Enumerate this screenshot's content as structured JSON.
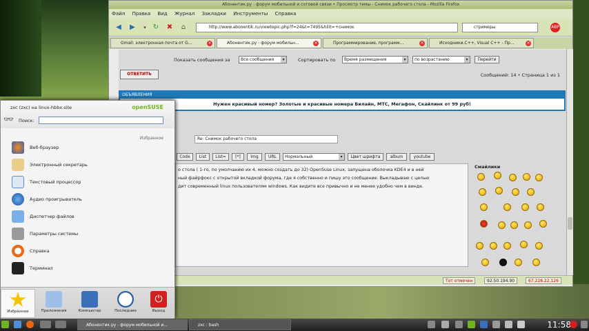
{
  "window": {
    "title": "Абонентик.ру - форум мобильной и сотовой связи • Просмотр темы - Снимок рабочего стола - Mozilla Firefox",
    "menu": [
      "Файл",
      "Правка",
      "Вид",
      "Журнал",
      "Закладки",
      "Инструменты",
      "Справка"
    ],
    "url": "http://www.abonentik.ru/viewtopic.php?f=24&t=7495&hilit=+снимок",
    "search_value": "стримеры",
    "tabs": [
      {
        "label": "Gmail: электронная почта от G...",
        "active": false
      },
      {
        "label": "Абонентик.ру - форум мобильн...",
        "active": true
      },
      {
        "label": "Программирование, программ...",
        "active": false
      },
      {
        "label": "Исходники.C++, Visual C++ - Пр...",
        "active": false
      }
    ],
    "status": {
      "left": "",
      "certificate": "Тот отмечен",
      "ip1": "92.50.194.90",
      "ip2": "67.228.22.126"
    }
  },
  "forum": {
    "show_label": "Показать сообщения за",
    "show_value": "Все сообщения",
    "sort_label": "Сортировать по",
    "sort_value": "Время размещения",
    "order_value": "по возрастанию",
    "go_button": "Перейти",
    "reply_button": "ОТВЕТИТЬ",
    "pagination": "Сообщений: 14 • Страница 1 из 1",
    "ad_header": "ОБЪЯВЛЕНИЯ",
    "ad_text": "Нужен красивый номер? Золотые и красивые номера Билайн, МТС, Мегафон, Скайлинк от 99 руб!",
    "subject_value": "Re: Снимок рабочего стола",
    "toolbar": [
      "Code",
      "List",
      "List=",
      "[*]",
      "Img",
      "URL"
    ],
    "font_size_value": "Нормальный",
    "toolbar2": [
      "Цвет шрифта",
      "album",
      "youtube"
    ],
    "body_lines": [
      "о стола ( 1-го, по умолчанию их 4, можно создать до 32) OpenSuse Linux, запущена оболочка KDE4 и в ней",
      "ный файрфокс с открытой вкладкой форума, где я собственно и пишу это сообщение. Выкладываю с целью",
      "дит современный linux пользователям  windows. Как видите все привычно и не менее удобно чем в винде."
    ],
    "smilies_title": "Смайлики"
  },
  "kmenu": {
    "user": "zxc (zxc) на linux-hbbx.site",
    "brand": "openSUSE",
    "search_label": "Поиск:",
    "search_value": "",
    "section": "Избранное",
    "items": [
      {
        "label": "Веб-браузер",
        "icon": "firefox-icon",
        "color": "#e8661a"
      },
      {
        "label": "Электронный секретарь",
        "icon": "organizer-icon",
        "color": "#d9b34a"
      },
      {
        "label": "Текстовый процессор",
        "icon": "text-processor-icon",
        "color": "#5a8fcf"
      },
      {
        "label": "Аудио проигрыватель",
        "icon": "audio-player-icon",
        "color": "#2c6fbf"
      },
      {
        "label": "Диспетчер файлов",
        "icon": "file-manager-icon",
        "color": "#4d8fd9"
      },
      {
        "label": "Параметры системы",
        "icon": "system-settings-icon",
        "color": "#8a8a8a"
      },
      {
        "label": "Справка",
        "icon": "help-icon",
        "color": "#e86a1a"
      },
      {
        "label": "Терминал",
        "icon": "terminal-icon",
        "color": "#222222"
      }
    ],
    "bottom": [
      {
        "label": "Избранное",
        "icon": "favorites-star-icon",
        "color": "#f0b800"
      },
      {
        "label": "Приложения",
        "icon": "applications-icon",
        "color": "#6a9ed8"
      },
      {
        "label": "Компьютер",
        "icon": "computer-icon",
        "color": "#3a70b8"
      },
      {
        "label": "Последние",
        "icon": "recent-clock-icon",
        "color": "#2a5aa0"
      },
      {
        "label": "Выход",
        "icon": "power-icon",
        "color": "#d02020"
      }
    ]
  },
  "taskbar": {
    "tasks": [
      "Абонентик.ру - форум мобильной и...",
      "zxc : bash"
    ],
    "clock": "11:58"
  }
}
